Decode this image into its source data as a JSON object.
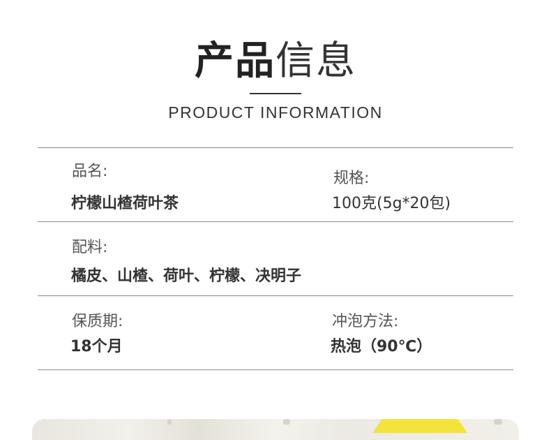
{
  "header": {
    "title_bold": "产品",
    "title_light": "信息",
    "subtitle": "PRODUCT INFORMATION"
  },
  "info": {
    "name_label": "品名:",
    "name_value": "柠檬山楂荷叶茶",
    "spec_label": "规格:",
    "spec_value": "100克(5g*20包)",
    "ingredients_label": "配料:",
    "ingredients_value": "橘皮、山楂、荷叶、柠檬、决明子",
    "shelf_life_label": "保质期:",
    "shelf_life_value": "18个月",
    "brew_label": "冲泡方法:",
    "brew_value": "热泡（90℃）"
  },
  "colors": {
    "text_dark": "#333333",
    "label_gray": "#555555",
    "rule": "#888888",
    "lemon_yellow": "#f4e33a"
  }
}
